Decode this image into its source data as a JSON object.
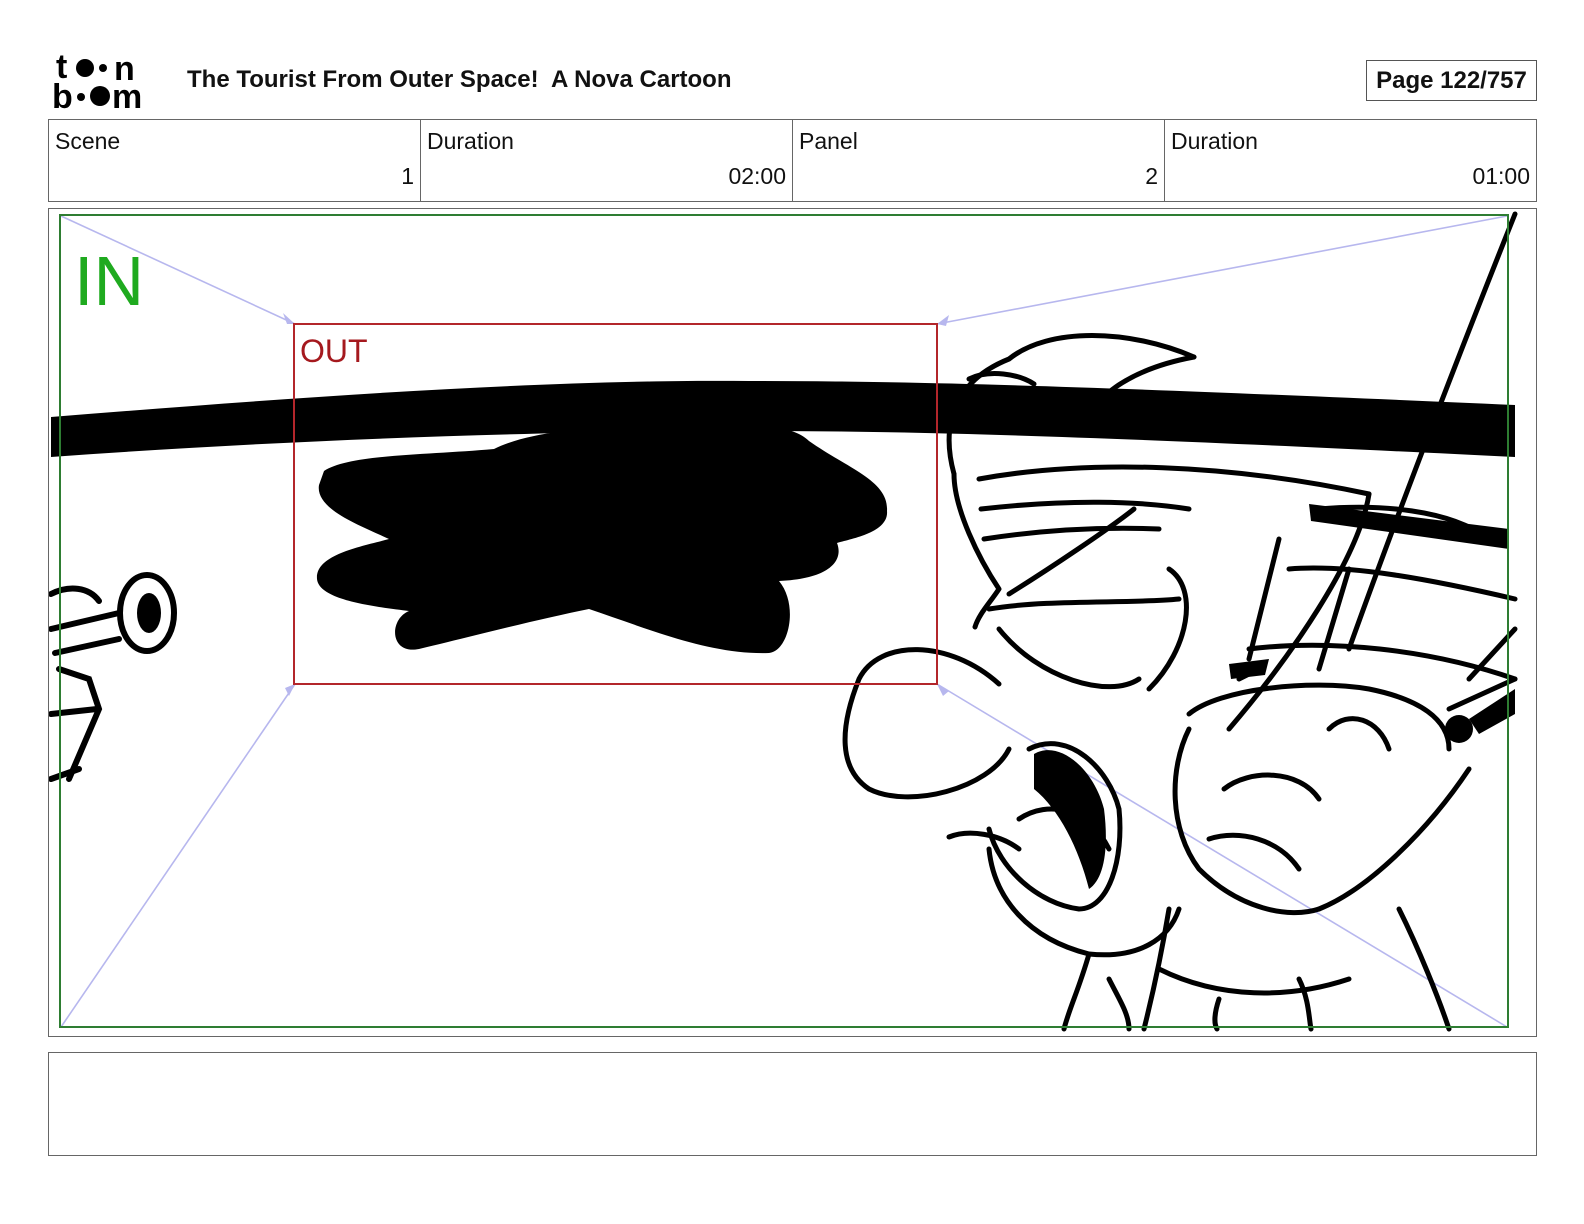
{
  "header": {
    "logo_top": "toon",
    "logo_bottom": "boom",
    "title": "The Tourist From Outer Space!  A Nova Cartoon",
    "page": "Page 122/757"
  },
  "info": {
    "scene_label": "Scene",
    "scene_value": "1",
    "scene_duration_label": "Duration",
    "scene_duration_value": "02:00",
    "panel_label": "Panel",
    "panel_value": "2",
    "panel_duration_label": "Duration",
    "panel_duration_value": "01:00"
  },
  "panel": {
    "in_label": "IN",
    "out_label": "OUT",
    "colors": {
      "in_frame": "#2e7d32",
      "in_text": "#1faa1f",
      "out_frame": "#b3262b",
      "out_text": "#a5191e",
      "guide_lines": "#b7b7ee",
      "ink": "#000000"
    }
  },
  "notes": {
    "text": ""
  }
}
